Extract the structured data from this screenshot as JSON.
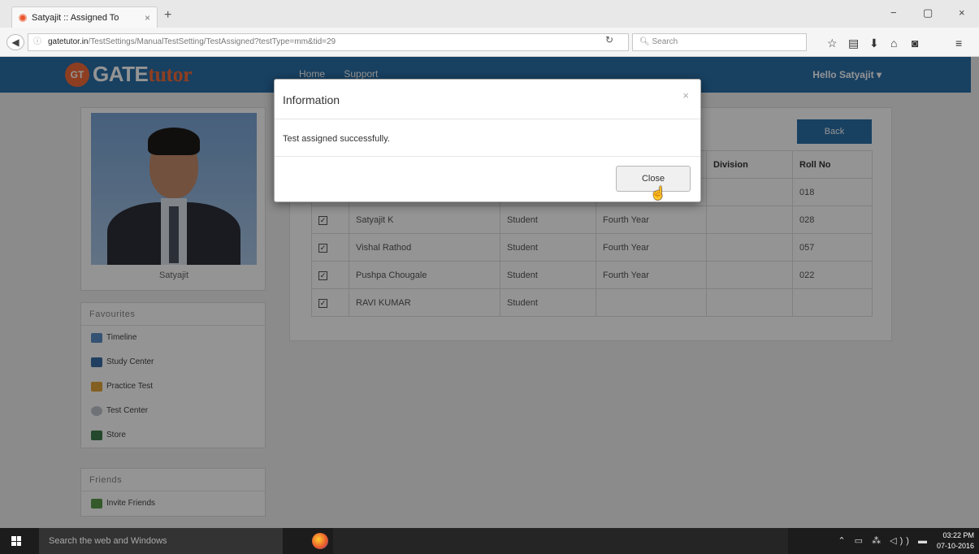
{
  "browser": {
    "tab_title": "Satyajit :: Assigned To",
    "tab_close": "×",
    "new_tab": "+",
    "url_domain": "gatetutor.in",
    "url_path": "/TestSettings/ManualTestSetting/TestAssigned?testType=mm&tid=29",
    "search_placeholder": "Search",
    "minimize": "−",
    "maximize": "▢",
    "close": "×"
  },
  "site": {
    "logo_badge": "GT",
    "logo_main": "GATE",
    "logo_sub": "tutor",
    "nav": [
      "Home",
      "Support"
    ],
    "greeting": "Hello Satyajit ▾"
  },
  "profile": {
    "name": "Satyajit"
  },
  "favourites": {
    "header": "Favourites",
    "items": [
      "Timeline",
      "Study Center",
      "Practice Test",
      "Test Center",
      "Store"
    ]
  },
  "friends": {
    "header": "Friends",
    "items": [
      "Invite Friends"
    ]
  },
  "panel": {
    "back_label": "Back",
    "columns": [
      "",
      "",
      "",
      "",
      "Division",
      "Roll No"
    ],
    "rows": [
      {
        "name": "",
        "role": "",
        "year": "",
        "division": "",
        "roll": "018"
      },
      {
        "name": "Satyajit K",
        "role": "Student",
        "year": "Fourth Year",
        "division": "",
        "roll": "028"
      },
      {
        "name": "Vishal Rathod",
        "role": "Student",
        "year": "Fourth Year",
        "division": "",
        "roll": "057"
      },
      {
        "name": "Pushpa Chougale",
        "role": "Student",
        "year": "Fourth Year",
        "division": "",
        "roll": "022"
      },
      {
        "name": "RAVI KUMAR",
        "role": "Student",
        "year": "",
        "division": "",
        "roll": ""
      }
    ]
  },
  "modal": {
    "title": "Information",
    "close_x": "×",
    "message": "Test assigned successfully.",
    "close_label": "Close"
  },
  "taskbar": {
    "search_placeholder": "Search the web and Windows",
    "time": "03:22 PM",
    "date": "07-10-2016"
  }
}
